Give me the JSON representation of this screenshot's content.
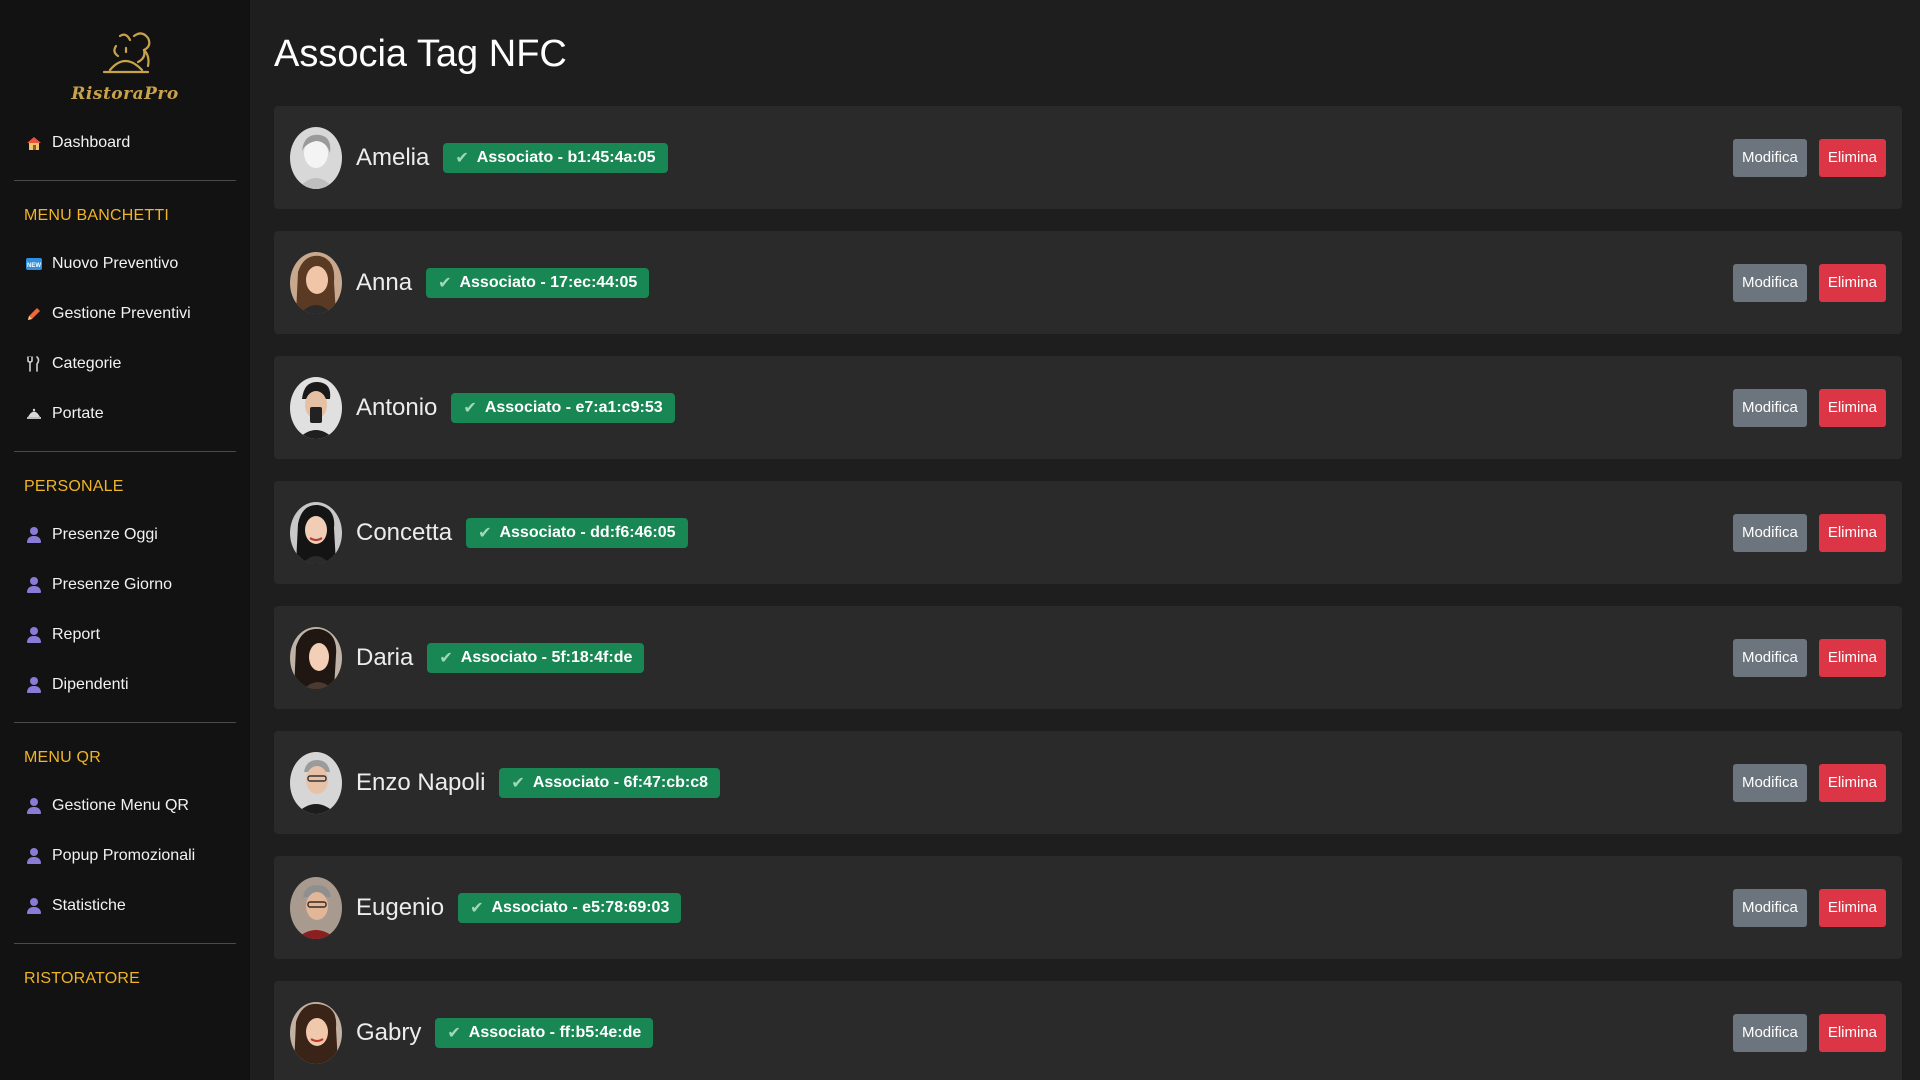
{
  "brand": {
    "name": "RistoraPro",
    "color": "#c9a34a"
  },
  "sidebar": {
    "top_items": [
      {
        "label": "Dashboard",
        "icon": "house-icon"
      }
    ],
    "sections": [
      {
        "title": "MENU BANCHETTI",
        "items": [
          {
            "label": "Nuovo Preventivo",
            "icon": "new-badge-icon"
          },
          {
            "label": "Gestione Preventivi",
            "icon": "pencil-icon"
          },
          {
            "label": "Categorie",
            "icon": "fork-knife-icon"
          },
          {
            "label": "Portate",
            "icon": "cloche-icon"
          }
        ]
      },
      {
        "title": "PERSONALE",
        "items": [
          {
            "label": "Presenze Oggi",
            "icon": "person-icon"
          },
          {
            "label": "Presenze Giorno",
            "icon": "person-icon"
          },
          {
            "label": "Report",
            "icon": "person-icon"
          },
          {
            "label": "Dipendenti",
            "icon": "person-icon"
          }
        ]
      },
      {
        "title": "MENU QR",
        "items": [
          {
            "label": "Gestione Menu QR",
            "icon": "person-icon"
          },
          {
            "label": "Popup Promozionali",
            "icon": "person-icon"
          },
          {
            "label": "Statistiche",
            "icon": "person-icon"
          }
        ]
      },
      {
        "title": "RISTORATORE",
        "items": []
      }
    ]
  },
  "page": {
    "title": "Associa Tag NFC"
  },
  "employees": [
    {
      "name": "Amelia",
      "badge": "Associato - b1:45:4a:05",
      "edit": "Modifica",
      "delete": "Elimina"
    },
    {
      "name": "Anna",
      "badge": "Associato - 17:ec:44:05",
      "edit": "Modifica",
      "delete": "Elimina"
    },
    {
      "name": "Antonio",
      "badge": "Associato - e7:a1:c9:53",
      "edit": "Modifica",
      "delete": "Elimina"
    },
    {
      "name": "Concetta",
      "badge": "Associato - dd:f6:46:05",
      "edit": "Modifica",
      "delete": "Elimina"
    },
    {
      "name": "Daria",
      "badge": "Associato - 5f:18:4f:de",
      "edit": "Modifica",
      "delete": "Elimina"
    },
    {
      "name": "Enzo Napoli",
      "badge": "Associato - 6f:47:cb:c8",
      "edit": "Modifica",
      "delete": "Elimina"
    },
    {
      "name": "Eugenio",
      "badge": "Associato - e5:78:69:03",
      "edit": "Modifica",
      "delete": "Elimina"
    },
    {
      "name": "Gabry",
      "badge": "Associato - ff:b5:4e:de",
      "edit": "Modifica",
      "delete": "Elimina"
    }
  ],
  "colors": {
    "accent_section": "#f0b428",
    "badge_green": "#198754",
    "edit_gray": "#6c757d",
    "delete_red": "#dc3545"
  }
}
